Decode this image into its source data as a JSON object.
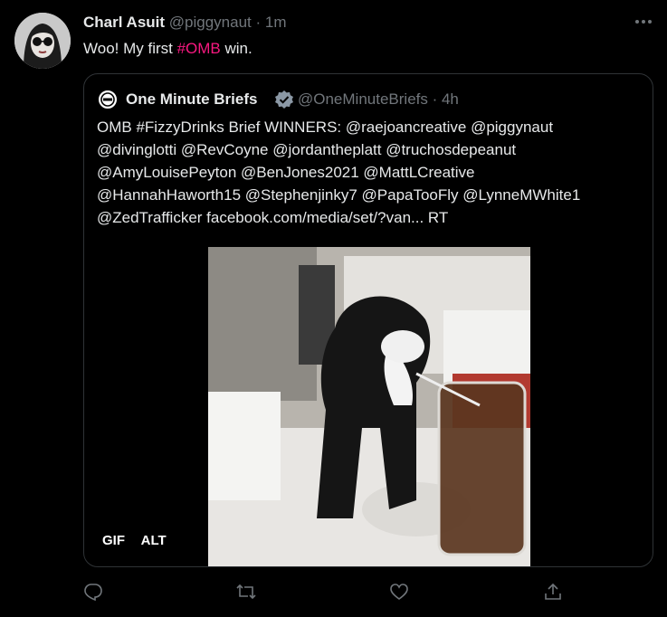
{
  "tweet": {
    "author_name": "Charl Asuit",
    "handle_time": "@piggynaut · 1m",
    "more_icon": "more-icon",
    "text_before": "Woo! My first ",
    "hashtag": "#OMB",
    "text_after": " win."
  },
  "quote": {
    "author_name": "One Minute Briefs",
    "handle_time": "@OneMinuteBriefs · 4h",
    "lines": [
      "OMB #FizzyDrinks Brief WINNERS: @raejoancreative @piggynaut",
      "@divinglotti @RevCoyne @jordantheplatt @truchosdepeanut",
      "@AmyLouisePeyton @BenJones2021 @MattLCreative",
      "@HannahHaworth15 @Stephenjinky7 @PapaTooFly @LynneMWhite1",
      "@ZedTrafficker facebook.com/media/set/?van... RT"
    ],
    "badge_gif": "GIF",
    "badge_alt": "ALT"
  },
  "actions": {
    "reply_icon": "reply-icon",
    "retweet_icon": "retweet-icon",
    "like_icon": "like-icon",
    "share_icon": "share-icon"
  },
  "colors": {
    "background": "#000000",
    "text": "#e7e9ea",
    "muted": "#71767b",
    "hashtag": "#f91880",
    "verified": "#8b98a5",
    "border": "#2f3336"
  }
}
